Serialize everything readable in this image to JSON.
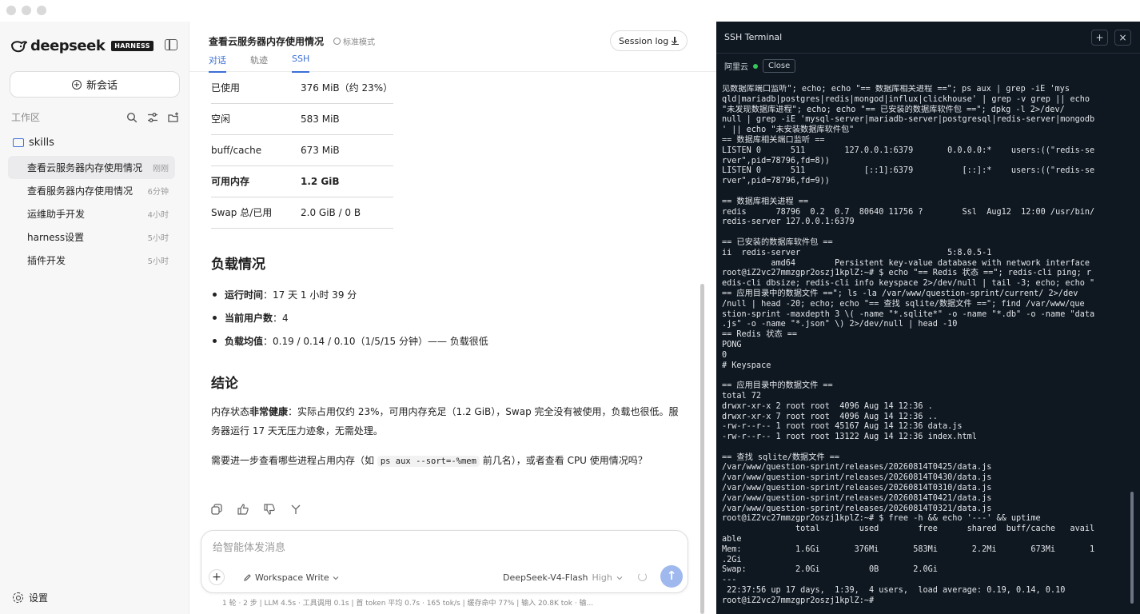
{
  "sidebar": {
    "logo_text": "deepseek",
    "badge": "HARNESS",
    "new_chat": "新会话",
    "workspace_label": "工作区",
    "folder": "skills",
    "sessions": [
      {
        "name": "查看云服务器内存使用情况",
        "time": "刚刚",
        "active": true
      },
      {
        "name": "查看服务器内存使用情况",
        "time": "6分钟"
      },
      {
        "name": "运维助手开发",
        "time": "4小时"
      },
      {
        "name": "harness设置",
        "time": "5小时"
      },
      {
        "name": "插件开发",
        "time": "5小时"
      }
    ],
    "settings": "设置"
  },
  "main": {
    "title": "查看云服务器内存使用情况",
    "mode": "标准模式",
    "session_log": "Session log",
    "tabs": [
      "对话",
      "轨迹",
      "SSH"
    ],
    "table": [
      {
        "k": "已使用",
        "v": "376 MiB（约 23%）"
      },
      {
        "k": "空闲",
        "v": "583 MiB"
      },
      {
        "k": "buff/cache",
        "v": "673 MiB"
      },
      {
        "k": "可用内存",
        "v": "1.2 GiB",
        "bold": true
      },
      {
        "k": "Swap 总/已用",
        "v": "2.0 GiB / 0 B"
      }
    ],
    "load_heading": "负载情况",
    "bullets": [
      {
        "label": "运行时间",
        "text": "：17 天 1 小时 39 分"
      },
      {
        "label": "当前用户数",
        "text": "：4"
      },
      {
        "label": "负载均值",
        "text": "：0.19 / 0.14 / 0.10（1/5/15 分钟）—— 负载很低"
      }
    ],
    "conclusion_heading": "结论",
    "p1_a": "内存状态",
    "p1_b": "非常健康",
    "p1_c": "：实际占用仅约 23%，可用内存充足（1.2 GiB），Swap 完全没有被使用，负载也很低。服务器运行 17 天无压力迹象，无需处理。",
    "p2_a": "需要进一步查看哪些进程占用内存（如 ",
    "p2_code": "ps aux --sort=-%mem",
    "p2_b": " 前几名），或者查看 CPU 使用情况吗？"
  },
  "composer": {
    "placeholder": "给智能体发消息",
    "workspace": "Workspace Write",
    "model": "DeepSeek-V4-Flash",
    "tier": "High",
    "status": "1 轮 · 2 步  |  LLM 4.5s · 工具调用 0.1s  |  首 token 平均 0.7s · 165 tok/s  |  缓存命中 77%  |  输入 20.8K tok · 输..."
  },
  "terminal": {
    "title": "SSH Terminal",
    "host": "阿里云",
    "close": "Close",
    "output": "见数据库端口监听\"; echo; echo \"== 数据库相关进程 ==\"; ps aux | grep -iE 'mys\nqld|mariadb|postgres|redis|mongod|influx|clickhouse' | grep -v grep || echo\n\"未发现数据库进程\"; echo; echo \"== 已安装的数据库软件包 ==\"; dpkg -l 2>/dev/\nnull | grep -iE 'mysql-server|mariadb-server|postgresql|redis-server|mongodb\n' || echo \"未安装数据库软件包\"\n== 数据库相关端口监听 ==\nLISTEN 0      511        127.0.0.1:6379       0.0.0.0:*    users:((\"redis-se\nrver\",pid=78796,fd=8))\nLISTEN 0      511            [::1]:6379          [::]:*    users:((\"redis-se\nrver\",pid=78796,fd=9))\n\n== 数据库相关进程 ==\nredis      78796  0.2  0.7  80640 11756 ?        Ssl  Aug12  12:00 /usr/bin/\nredis-server 127.0.0.1:6379\n\n== 已安装的数据库软件包 ==\nii  redis-server                              5:8.0.5-1\n          amd64        Persistent key-value database with network interface\nroot@iZ2vc27mmzgpr2oszj1kplZ:~# $ echo \"== Redis 状态 ==\"; redis-cli ping; r\nedis-cli dbsize; redis-cli info keyspace 2>/dev/null | tail -3; echo; echo \"\n== 应用目录中的数据文件 ==\"; ls -la /var/www/question-sprint/current/ 2>/dev\n/null | head -20; echo; echo \"== 查找 sqlite/数据文件 ==\"; find /var/www/que\nstion-sprint -maxdepth 3 \\( -name \"*.sqlite*\" -o -name \"*.db\" -o -name \"data\n.js\" -o -name \"*.json\" \\) 2>/dev/null | head -10\n== Redis 状态 ==\nPONG\n0\n# Keyspace\n\n== 应用目录中的数据文件 ==\ntotal 72\ndrwxr-xr-x 2 root root  4096 Aug 14 12:36 .\ndrwxr-xr-x 7 root root  4096 Aug 14 12:36 ..\n-rw-r--r-- 1 root root 45167 Aug 14 12:36 data.js\n-rw-r--r-- 1 root root 13122 Aug 14 12:36 index.html\n\n== 查找 sqlite/数据文件 ==\n/var/www/question-sprint/releases/20260814T0425/data.js\n/var/www/question-sprint/releases/20260814T0430/data.js\n/var/www/question-sprint/releases/20260814T0310/data.js\n/var/www/question-sprint/releases/20260814T0421/data.js\n/var/www/question-sprint/releases/20260814T0321/data.js\nroot@iZ2vc27mmzgpr2oszj1kplZ:~# $ free -h && echo '---' && uptime\n               total        used        free      shared  buff/cache   avail\nable\nMem:           1.6Gi       376Mi       583Mi       2.2Mi       673Mi       1\n.2Gi\nSwap:          2.0Gi          0B       2.0Gi\n---\n 22:37:56 up 17 days,  1:39,  4 users,  load average: 0.19, 0.14, 0.10\nroot@iZ2vc27mmzgpr2oszj1kplZ:~#"
  },
  "colors": {
    "accent": "#3b6fd6",
    "terminal_bg": "#0f1720",
    "online": "#34c759"
  }
}
